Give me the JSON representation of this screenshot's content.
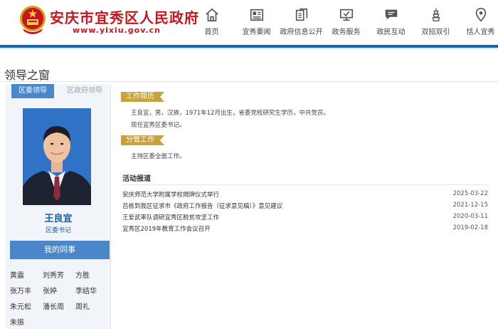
{
  "header": {
    "site_title": "安庆市宜秀区人民政府",
    "site_url": "www.yixiu.gov.cn",
    "nav": [
      {
        "label": "首页",
        "icon": "home-icon"
      },
      {
        "label": "宜秀要闻",
        "icon": "newspaper-icon"
      },
      {
        "label": "政府信息公开",
        "icon": "document-icon"
      },
      {
        "label": "政务服务",
        "icon": "monitor-icon"
      },
      {
        "label": "政民互动",
        "icon": "chat-icon"
      },
      {
        "label": "双招双引",
        "icon": "tower-icon"
      },
      {
        "label": "恬人宜秀",
        "icon": "location-pin-icon"
      }
    ]
  },
  "page": {
    "title": "领导之窗"
  },
  "tabs": [
    {
      "label": "区委领导",
      "active": true
    },
    {
      "label": "区政府领导",
      "active": false
    }
  ],
  "leader": {
    "name": "王良宜",
    "position": "区委书记"
  },
  "colleagues": {
    "header": "我的同事",
    "names": [
      "黄震",
      "刘秀芳",
      "方胜",
      "张万丰",
      "张婷",
      "李结华",
      "朱元松",
      "潘长周",
      "周礼",
      "朱振"
    ]
  },
  "work_history": {
    "badge": "工作简历",
    "lines": [
      "王良宜，男，汉族，1971年12月出生，省委党校研究生学历，中共党员。",
      "现任宜秀区委书记。"
    ]
  },
  "responsibilities": {
    "badge": "分管工作",
    "text": "主持区委全面工作。"
  },
  "activities": {
    "title": "活动报道",
    "items": [
      {
        "title": "安庆师范大学附属学校揭牌仪式举行",
        "date": "2025-03-22"
      },
      {
        "title": "吕栋到我区征求市《政府工作报告（征求意见稿）》意见建议",
        "date": "2021-12-15"
      },
      {
        "title": "王爱武率队调研宜秀区脱贫攻坚工作",
        "date": "2020-03-11"
      },
      {
        "title": "宜秀区2019年教育工作会议召开",
        "date": "2019-02-18"
      }
    ]
  },
  "colors": {
    "brand_red": "#c9151e",
    "accent_blue": "#4b86c8",
    "badge_gold": "#c9a23e",
    "header_bar": "#1a64b4"
  }
}
